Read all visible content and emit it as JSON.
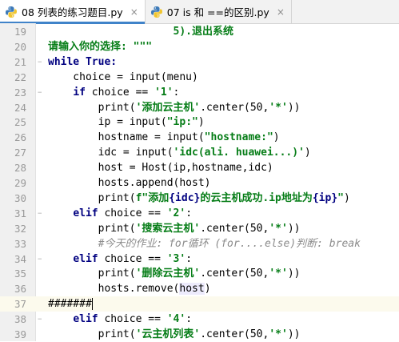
{
  "tabs": [
    {
      "label": "08 列表的练习题目.py",
      "close": "×"
    },
    {
      "label": "07 is 和 ==的区别.py",
      "close": "×"
    }
  ],
  "lines": [
    {
      "n": "19",
      "parts": [
        {
          "t": "                    5).退出系统",
          "c": "s"
        }
      ]
    },
    {
      "n": "20",
      "parts": [
        {
          "t": "请输入你的选择: \"\"\"",
          "c": "s"
        }
      ]
    },
    {
      "n": "21",
      "parts": [
        {
          "t": "while True",
          "c": "k"
        },
        {
          "t": ":",
          "c": "k"
        }
      ]
    },
    {
      "n": "22",
      "parts": [
        {
          "t": "    choice = input(menu)",
          "c": ""
        }
      ]
    },
    {
      "n": "23",
      "parts": [
        {
          "t": "    ",
          "c": ""
        },
        {
          "t": "if",
          "c": "k"
        },
        {
          "t": " choice == ",
          "c": ""
        },
        {
          "t": "'1'",
          "c": "s"
        },
        {
          "t": ":",
          "c": ""
        }
      ]
    },
    {
      "n": "24",
      "parts": [
        {
          "t": "        print(",
          "c": ""
        },
        {
          "t": "'添加云主机'",
          "c": "s"
        },
        {
          "t": ".center(50,",
          "c": ""
        },
        {
          "t": "'*'",
          "c": "s"
        },
        {
          "t": "))",
          "c": ""
        }
      ]
    },
    {
      "n": "25",
      "parts": [
        {
          "t": "        ip = input(",
          "c": ""
        },
        {
          "t": "\"ip:\"",
          "c": "s"
        },
        {
          "t": ")",
          "c": ""
        }
      ]
    },
    {
      "n": "26",
      "parts": [
        {
          "t": "        hostname = input(",
          "c": ""
        },
        {
          "t": "\"hostname:\"",
          "c": "s"
        },
        {
          "t": ")",
          "c": ""
        }
      ]
    },
    {
      "n": "27",
      "parts": [
        {
          "t": "        idc = input(",
          "c": ""
        },
        {
          "t": "'idc(ali. huawei...)'",
          "c": "s"
        },
        {
          "t": ")",
          "c": ""
        }
      ]
    },
    {
      "n": "28",
      "parts": [
        {
          "t": "        host = Host(ip,hostname,idc)",
          "c": ""
        }
      ]
    },
    {
      "n": "29",
      "parts": [
        {
          "t": "        hosts.append(host)",
          "c": ""
        }
      ]
    },
    {
      "n": "30",
      "parts": [
        {
          "t": "        print(",
          "c": ""
        },
        {
          "t": "f\"添加",
          "c": "s"
        },
        {
          "t": "{idc}",
          "c": "k"
        },
        {
          "t": "的云主机成功.ip地址为",
          "c": "s"
        },
        {
          "t": "{ip}",
          "c": "k"
        },
        {
          "t": "\"",
          "c": "s"
        },
        {
          "t": ")",
          "c": ""
        }
      ]
    },
    {
      "n": "31",
      "parts": [
        {
          "t": "    ",
          "c": ""
        },
        {
          "t": "elif",
          "c": "k"
        },
        {
          "t": " choice == ",
          "c": ""
        },
        {
          "t": "'2'",
          "c": "s"
        },
        {
          "t": ":",
          "c": ""
        }
      ]
    },
    {
      "n": "32",
      "parts": [
        {
          "t": "        print(",
          "c": ""
        },
        {
          "t": "'搜索云主机'",
          "c": "s"
        },
        {
          "t": ".center(50,",
          "c": ""
        },
        {
          "t": "'*'",
          "c": "s"
        },
        {
          "t": "))",
          "c": ""
        }
      ]
    },
    {
      "n": "33",
      "parts": [
        {
          "t": "        #今天的作业: for循环 (for....else)判断: break",
          "c": "cm"
        }
      ]
    },
    {
      "n": "34",
      "parts": [
        {
          "t": "    ",
          "c": ""
        },
        {
          "t": "elif",
          "c": "k"
        },
        {
          "t": " choice == ",
          "c": ""
        },
        {
          "t": "'3'",
          "c": "s"
        },
        {
          "t": ":",
          "c": ""
        }
      ]
    },
    {
      "n": "35",
      "parts": [
        {
          "t": "        print(",
          "c": ""
        },
        {
          "t": "'删除云主机'",
          "c": "s"
        },
        {
          "t": ".center(50,",
          "c": ""
        },
        {
          "t": "'*'",
          "c": "s"
        },
        {
          "t": "))",
          "c": ""
        }
      ]
    },
    {
      "n": "36",
      "parts": [
        {
          "t": "        hosts.remove(",
          "c": ""
        },
        {
          "t": "host",
          "c": "hl"
        },
        {
          "t": ")",
          "c": ""
        }
      ]
    },
    {
      "n": "37",
      "parts": [
        {
          "t": "#######",
          "c": ""
        }
      ],
      "current": true
    },
    {
      "n": "38",
      "parts": [
        {
          "t": "    ",
          "c": ""
        },
        {
          "t": "elif",
          "c": "k"
        },
        {
          "t": " choice == ",
          "c": ""
        },
        {
          "t": "'4'",
          "c": "s"
        },
        {
          "t": ":",
          "c": ""
        }
      ]
    },
    {
      "n": "39",
      "parts": [
        {
          "t": "        print(",
          "c": ""
        },
        {
          "t": "'云主机列表'",
          "c": "s"
        },
        {
          "t": ".center(50,",
          "c": ""
        },
        {
          "t": "'*'",
          "c": "s"
        },
        {
          "t": "))",
          "c": ""
        }
      ]
    }
  ]
}
